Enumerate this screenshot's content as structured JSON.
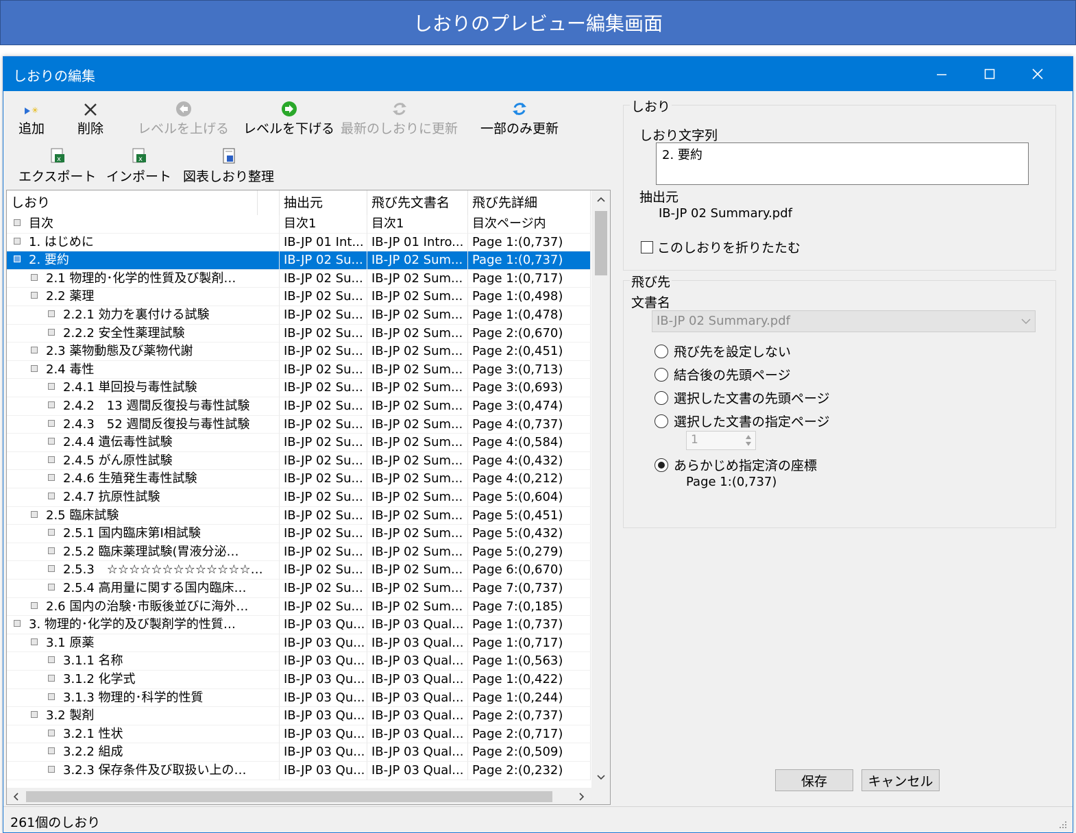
{
  "banner": {
    "title": "しおりのプレビュー編集画面"
  },
  "window": {
    "title": "しおりの編集"
  },
  "toolbar": {
    "add": "追加",
    "delete": "削除",
    "level_up": "レベルを上げる",
    "level_down": "レベルを下げる",
    "refresh_latest": "最新のしおりに更新",
    "partial_update": "一部のみ更新",
    "export": "エクスポート",
    "import": "インポート",
    "figure_bookmarks": "図表しおり整理"
  },
  "table": {
    "headers": [
      "しおり",
      "抽出元",
      "飛び先文書名",
      "飛び先詳細"
    ],
    "rows": [
      {
        "level": 0,
        "name": "目次",
        "src": "目次1",
        "doc": "目次1",
        "detail": "目次ページ内"
      },
      {
        "level": 0,
        "name": "1. はじめに",
        "src": "IB-JP 01 Int...",
        "doc": "IB-JP 01 Intro...",
        "detail": "Page 1:(0,737)"
      },
      {
        "level": 0,
        "name": "2. 要約",
        "src": "IB-JP 02 Su...",
        "doc": "IB-JP 02 Sum...",
        "detail": "Page 1:(0,737)",
        "selected": true
      },
      {
        "level": 1,
        "name": "2.1 物理的･化学的性質及び製剤…",
        "src": "IB-JP 02 Su...",
        "doc": "IB-JP 02 Sum...",
        "detail": "Page 1:(0,717)"
      },
      {
        "level": 1,
        "name": "2.2 薬理",
        "src": "IB-JP 02 Su...",
        "doc": "IB-JP 02 Sum...",
        "detail": "Page 1:(0,498)"
      },
      {
        "level": 2,
        "name": "2.2.1 効力を裏付ける試験",
        "src": "IB-JP 02 Su...",
        "doc": "IB-JP 02 Sum...",
        "detail": "Page 1:(0,478)"
      },
      {
        "level": 2,
        "name": "2.2.2 安全性薬理試験",
        "src": "IB-JP 02 Su...",
        "doc": "IB-JP 02 Sum...",
        "detail": "Page 2:(0,670)"
      },
      {
        "level": 1,
        "name": "2.3 薬物動態及び薬物代謝",
        "src": "IB-JP 02 Su...",
        "doc": "IB-JP 02 Sum...",
        "detail": "Page 2:(0,451)"
      },
      {
        "level": 1,
        "name": "2.4 毒性",
        "src": "IB-JP 02 Su...",
        "doc": "IB-JP 02 Sum...",
        "detail": "Page 3:(0,713)"
      },
      {
        "level": 2,
        "name": "2.4.1 単回投与毒性試験",
        "src": "IB-JP 02 Su...",
        "doc": "IB-JP 02 Sum...",
        "detail": "Page 3:(0,693)"
      },
      {
        "level": 2,
        "name": "2.4.2　13 週間反復投与毒性試験",
        "src": "IB-JP 02 Su...",
        "doc": "IB-JP 02 Sum...",
        "detail": "Page 3:(0,474)"
      },
      {
        "level": 2,
        "name": "2.4.3　52 週間反復投与毒性試験",
        "src": "IB-JP 02 Su...",
        "doc": "IB-JP 02 Sum...",
        "detail": "Page 4:(0,737)"
      },
      {
        "level": 2,
        "name": "2.4.4 遺伝毒性試験",
        "src": "IB-JP 02 Su...",
        "doc": "IB-JP 02 Sum...",
        "detail": "Page 4:(0,584)"
      },
      {
        "level": 2,
        "name": "2.4.5 がん原性試験",
        "src": "IB-JP 02 Su...",
        "doc": "IB-JP 02 Sum...",
        "detail": "Page 4:(0,432)"
      },
      {
        "level": 2,
        "name": "2.4.6 生殖発生毒性試験",
        "src": "IB-JP 02 Su...",
        "doc": "IB-JP 02 Sum...",
        "detail": "Page 4:(0,212)"
      },
      {
        "level": 2,
        "name": "2.4.7 抗原性試験",
        "src": "IB-JP 02 Su...",
        "doc": "IB-JP 02 Sum...",
        "detail": "Page 5:(0,604)"
      },
      {
        "level": 1,
        "name": "2.5 臨床試験",
        "src": "IB-JP 02 Su...",
        "doc": "IB-JP 02 Sum...",
        "detail": "Page 5:(0,451)"
      },
      {
        "level": 2,
        "name": "2.5.1 国内臨床第Ⅰ相試験",
        "src": "IB-JP 02 Su...",
        "doc": "IB-JP 02 Sum...",
        "detail": "Page 5:(0,432)"
      },
      {
        "level": 2,
        "name": "2.5.2 臨床薬理試験(胃液分泌…",
        "src": "IB-JP 02 Su...",
        "doc": "IB-JP 02 Sum...",
        "detail": "Page 5:(0,279)"
      },
      {
        "level": 2,
        "name": "2.5.3　☆☆☆☆☆☆☆☆☆☆☆☆☆…",
        "src": "IB-JP 02 Su...",
        "doc": "IB-JP 02 Sum...",
        "detail": "Page 6:(0,670)"
      },
      {
        "level": 2,
        "name": "2.5.4 高用量に関する国内臨床…",
        "src": "IB-JP 02 Su...",
        "doc": "IB-JP 02 Sum...",
        "detail": "Page 7:(0,737)"
      },
      {
        "level": 1,
        "name": "2.6 国内の治験･市販後並びに海外…",
        "src": "IB-JP 02 Su...",
        "doc": "IB-JP 02 Sum...",
        "detail": "Page 7:(0,185)"
      },
      {
        "level": 0,
        "name": "3. 物理的･化学的及び製剤学的性質…",
        "src": "IB-JP 03 Qu...",
        "doc": "IB-JP 03 Qual...",
        "detail": "Page 1:(0,737)"
      },
      {
        "level": 1,
        "name": "3.1 原薬",
        "src": "IB-JP 03 Qu...",
        "doc": "IB-JP 03 Qual...",
        "detail": "Page 1:(0,717)"
      },
      {
        "level": 2,
        "name": "3.1.1 名称",
        "src": "IB-JP 03 Qu...",
        "doc": "IB-JP 03 Qual...",
        "detail": "Page 1:(0,563)"
      },
      {
        "level": 2,
        "name": "3.1.2 化学式",
        "src": "IB-JP 03 Qu...",
        "doc": "IB-JP 03 Qual...",
        "detail": "Page 1:(0,422)"
      },
      {
        "level": 2,
        "name": "3.1.3 物理的･科学的性質",
        "src": "IB-JP 03 Qu...",
        "doc": "IB-JP 03 Qual...",
        "detail": "Page 1:(0,244)"
      },
      {
        "level": 1,
        "name": "3.2 製剤",
        "src": "IB-JP 03 Qu...",
        "doc": "IB-JP 03 Qual...",
        "detail": "Page 2:(0,737)"
      },
      {
        "level": 2,
        "name": "3.2.1 性状",
        "src": "IB-JP 03 Qu...",
        "doc": "IB-JP 03 Qual...",
        "detail": "Page 2:(0,717)"
      },
      {
        "level": 2,
        "name": "3.2.2 組成",
        "src": "IB-JP 03 Qu...",
        "doc": "IB-JP 03 Qual...",
        "detail": "Page 2:(0,509)"
      },
      {
        "level": 2,
        "name": "3.2.3 保存条件及び取扱い上の…",
        "src": "IB-JP 03 Qu...",
        "doc": "IB-JP 03 Qual...",
        "detail": "Page 2:(0,232)"
      }
    ]
  },
  "status": {
    "count": "261個のしおり"
  },
  "bookmark_panel": {
    "group_title": "しおり",
    "text_label": "しおり文字列",
    "text_value": "2. 要約",
    "source_label": "抽出元",
    "source_value": "IB-JP 02 Summary.pdf",
    "collapse_label": "このしおりを折りたたむ"
  },
  "target_panel": {
    "group_title": "飛び先",
    "doc_label": "文書名",
    "doc_value": "IB-JP 02 Summary.pdf",
    "options": [
      "飛び先を設定しない",
      "結合後の先頭ページ",
      "選択した文書の先頭ページ",
      "選択した文書の指定ページ",
      "あらかじめ指定済の座標"
    ],
    "selected_option": "あらかじめ指定済の座標",
    "page_spin_value": "1",
    "coord_value": "Page 1:(0,737)"
  },
  "buttons": {
    "save": "保存",
    "cancel": "キャンセル"
  },
  "colors": {
    "banner": "#4472c4",
    "titlebar": "#0078d7",
    "selection": "#0078d7"
  }
}
